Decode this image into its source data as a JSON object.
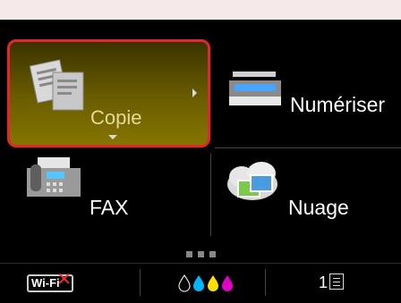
{
  "home_menu": {
    "tiles": [
      {
        "label": "Copie",
        "icon": "copy-icon"
      },
      {
        "label": "Numériser",
        "icon": "scanner-icon"
      },
      {
        "label": "FAX",
        "icon": "fax-icon"
      },
      {
        "label": "Nuage",
        "icon": "cloud-icon"
      }
    ],
    "selected_tile": "Copie",
    "highlight_color": "#e2262b"
  },
  "status_bar": {
    "wifi_label": "Wi-Fi",
    "wifi_state": "disconnected",
    "ink_colors": [
      "#000000",
      "#00b7ff",
      "#ffe000",
      "#e000c8"
    ],
    "queue_count": "1"
  }
}
